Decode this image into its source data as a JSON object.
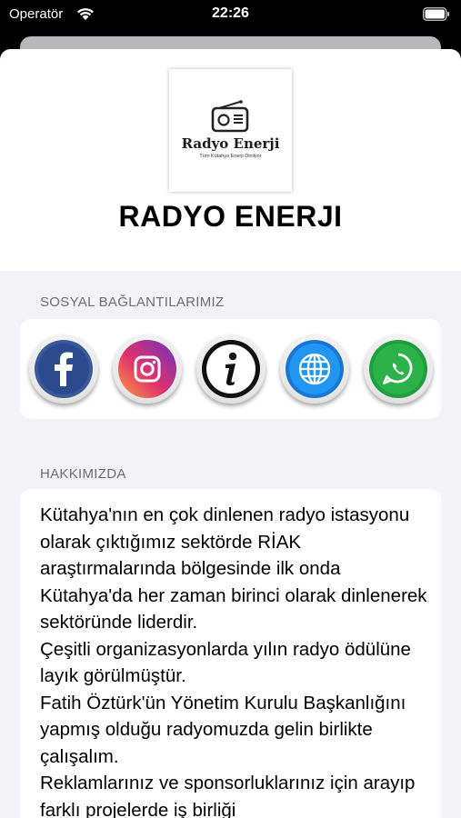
{
  "status_bar": {
    "carrier": "Operatör",
    "time": "22:26"
  },
  "logo": {
    "name": "Radyo Enerji",
    "tagline": "Tüm Kütahya Enerji Dinliyor"
  },
  "station_title": "RADYO ENERJI",
  "social": {
    "label": "SOSYAL BAĞLANTILARIMIZ",
    "items": [
      {
        "name": "facebook",
        "icon": "facebook-icon",
        "color": "#3b5998"
      },
      {
        "name": "instagram",
        "icon": "instagram-icon",
        "color": "#e1306c"
      },
      {
        "name": "info",
        "icon": "info-icon",
        "color": "#111111"
      },
      {
        "name": "website",
        "icon": "globe-icon",
        "color": "#1976d2"
      },
      {
        "name": "whatsapp",
        "icon": "whatsapp-icon",
        "color": "#25a244"
      }
    ]
  },
  "about": {
    "label": "HAKKIMIZDA",
    "text": "Kütahya'nın en çok dinlenen radyo istasyonu olarak çıktığımız sektörde RİAK araştırmalarında bölgesinde ilk onda Kütahya'da her zaman birinci olarak dinlenerek sektöründe liderdir.\nÇeşitli organizasyonlarda yılın radyo ödülüne layık görülmüştür.\nFatih Öztürk'ün Yönetim Kurulu Başkanlığını yapmış olduğu radyomuzda gelin birlikte çalışalım.\nReklamlarınız ve sponsorluklarınız için arayıp farklı projelerde iş birliği"
  }
}
